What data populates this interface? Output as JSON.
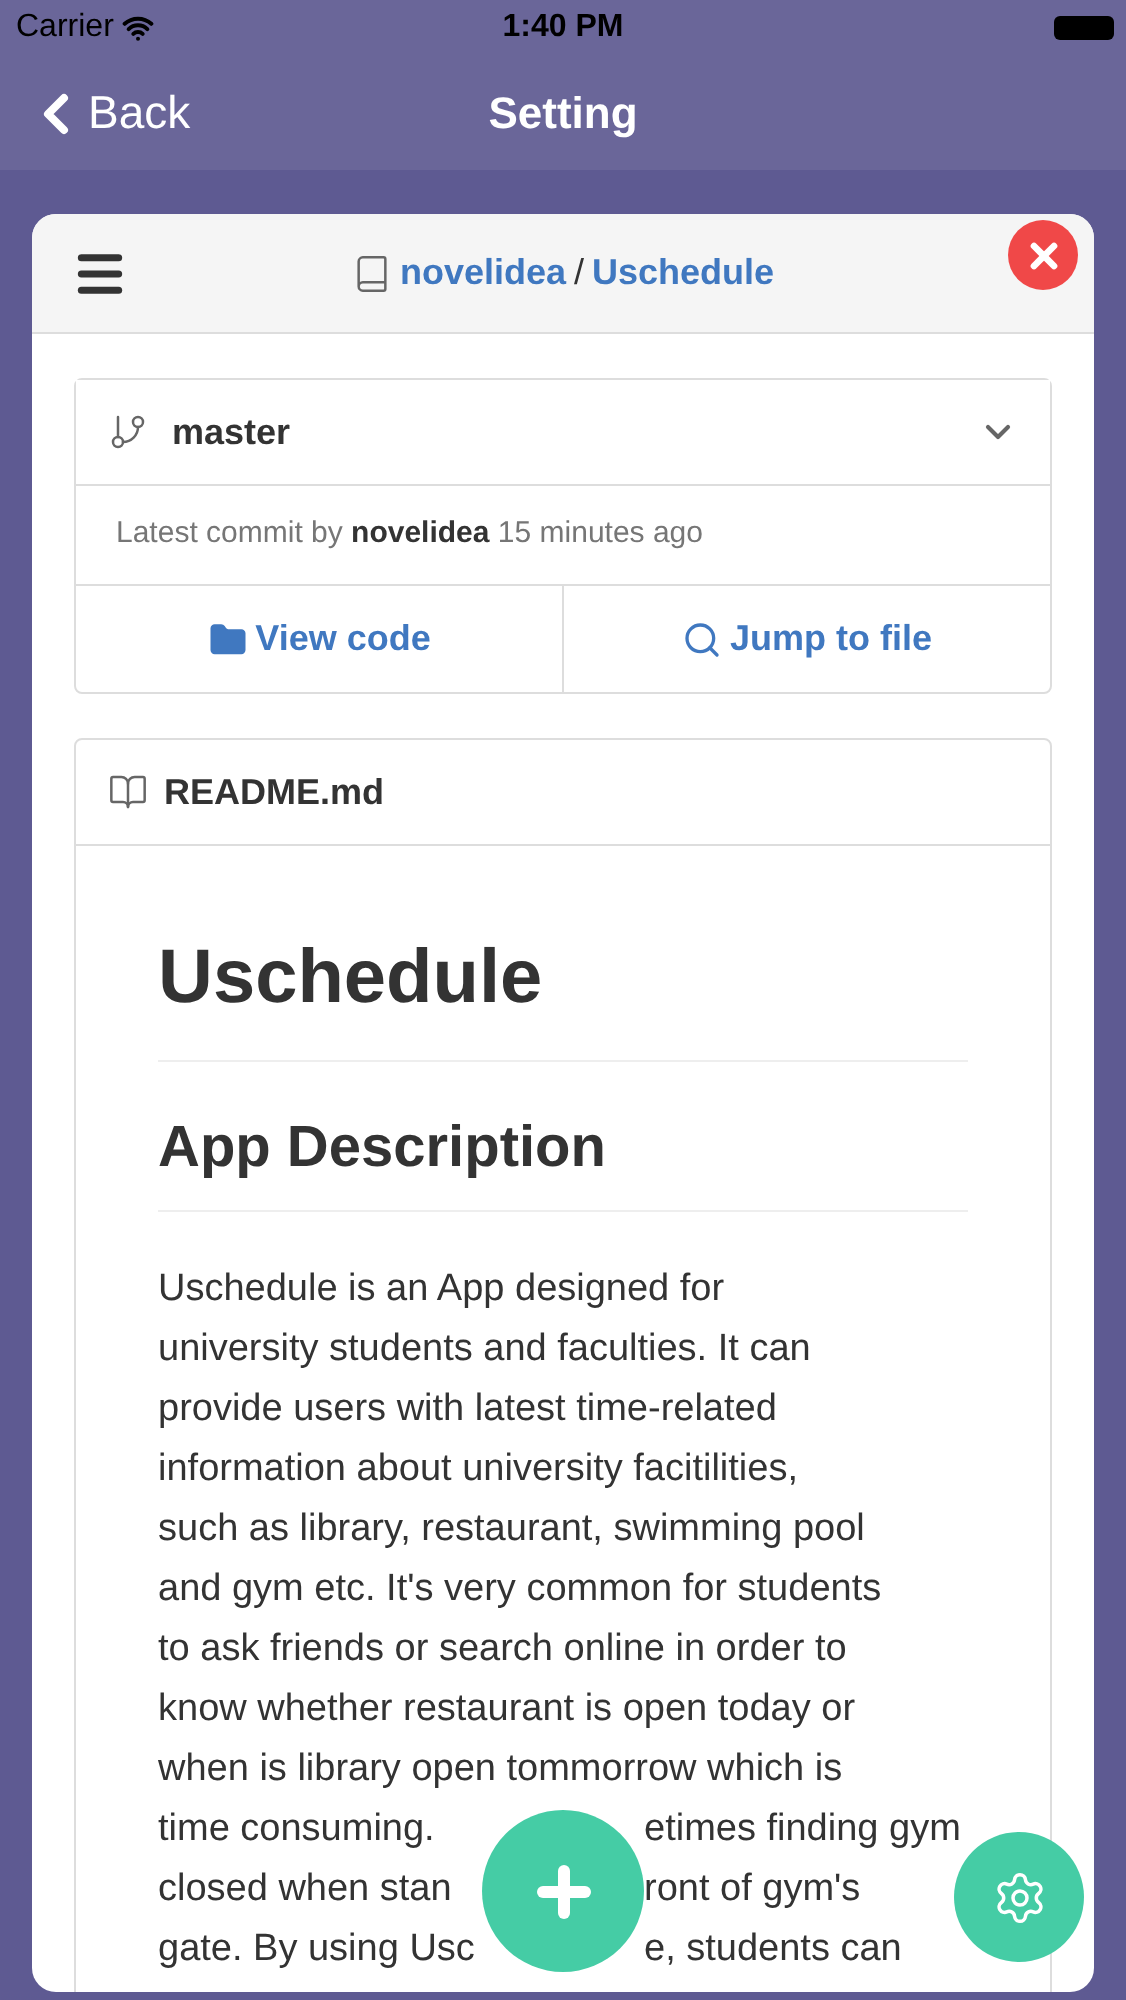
{
  "status_bar": {
    "carrier": "Carrier",
    "time": "1:40 PM"
  },
  "nav_bar": {
    "back": "Back",
    "title": "Setting"
  },
  "repo_header": {
    "owner": "novelidea",
    "separator": "/",
    "repo": "Uschedule"
  },
  "branch": {
    "name": "master",
    "expanded": false
  },
  "commit": {
    "prefix": "Latest commit by",
    "author": "novelidea",
    "time": "15 minutes ago"
  },
  "actions": [
    {
      "label": "View code",
      "kind": "folder"
    },
    {
      "label": "Jump to file",
      "kind": "search"
    }
  ],
  "readme": {
    "filename": "README.md",
    "title": "Uschedule",
    "heading": "App Description",
    "paragraph_lines": [
      [
        "Uschedule is an App designed for"
      ],
      [
        "university students and faculties. It can"
      ],
      [
        "provide users with latest time-related"
      ],
      [
        "information about university facitilities,"
      ],
      [
        "such as library, restaurant, swimming pool"
      ],
      [
        "and gym etc. It's very common for students"
      ],
      [
        "to ask friends or search online in order to"
      ],
      [
        "know whether restaurant is open today or"
      ],
      [
        "when is library open tommorrow which is"
      ],
      [
        "time consuming.",
        "etimes finding gym"
      ],
      [
        "closed when stan",
        "ront of gym's"
      ],
      [
        "gate. By using Usc",
        "e, students can"
      ]
    ]
  }
}
